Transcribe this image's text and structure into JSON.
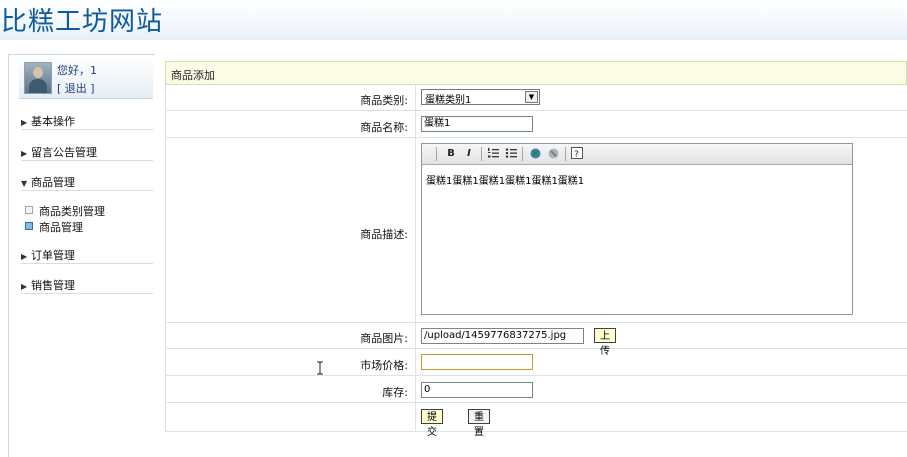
{
  "site": {
    "title": "比糕工坊网站"
  },
  "user": {
    "greeting": "您好，1",
    "logout": "[ 退出 ]"
  },
  "nav": {
    "basic": "基本操作",
    "notice": "留言公告管理",
    "goods": "商品管理",
    "goods_sub": [
      "商品类别管理",
      "商品管理"
    ],
    "orders": "订单管理",
    "sales": "销售管理"
  },
  "form": {
    "title": "商品添加",
    "category": {
      "label": "商品类别:",
      "value": "蛋糕类别1"
    },
    "name": {
      "label": "商品名称:",
      "value": "蛋糕1"
    },
    "description": {
      "label": "商品描述:",
      "text": "蛋糕1蛋糕1蛋糕1蛋糕1蛋糕1蛋糕1"
    },
    "image": {
      "label": "商品图片:",
      "value": "/upload/1459776837275.jpg",
      "upload_label": "上传"
    },
    "price": {
      "label": "市场价格:",
      "value": ""
    },
    "stock": {
      "label": "库存:",
      "value": "0"
    },
    "submit_label": "提交",
    "reset_label": "重置"
  },
  "toolbar": [
    "B",
    "I",
    "ordered-list-icon",
    "unordered-list-icon",
    "link-icon",
    "unlink-icon",
    "help-icon"
  ],
  "colors": {
    "title": "#0d5a9e",
    "panel_head": "#fbfbe6",
    "button": "#ffffd1"
  }
}
